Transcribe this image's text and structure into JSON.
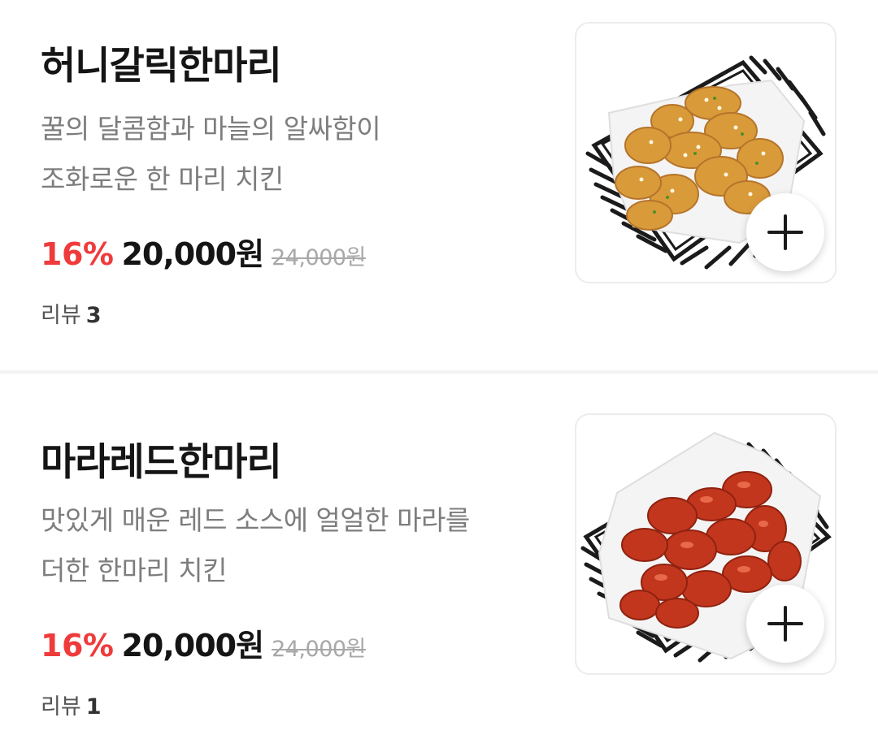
{
  "menu": {
    "items": [
      {
        "name": "허니갈릭한마리",
        "description_lines": [
          "꿀의 달콤함과 마늘의 알싸함이",
          "조화로운 한 마리 치킨"
        ],
        "discount": "16%",
        "price": "20,000원",
        "original_price": "24,000원",
        "review_label": "리뷰",
        "review_count": "3",
        "image_icon": "honey-garlic-chicken-basket",
        "add_icon": "plus-icon"
      },
      {
        "name": "마라레드한마리",
        "description_lines": [
          "맛있게 매운 레드 소스에 얼얼한 마라를",
          "더한 한마리 치킨"
        ],
        "discount": "16%",
        "price": "20,000원",
        "original_price": "24,000원",
        "review_label": "리뷰",
        "review_count": "1",
        "image_icon": "mala-red-chicken-basket",
        "add_icon": "plus-icon"
      }
    ]
  },
  "colors": {
    "discount": "#ef3b3b",
    "title": "#151515",
    "description": "#7d7d7d",
    "original_price": "#a8a8a8",
    "honey_chicken": "#d99a3a",
    "red_chicken": "#c2361e"
  }
}
